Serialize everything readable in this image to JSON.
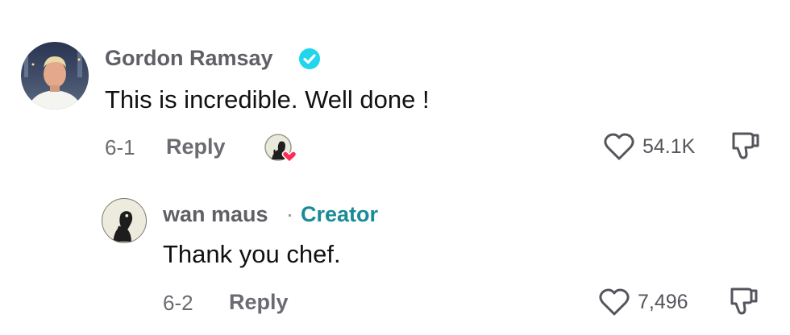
{
  "comment": {
    "username": "Gordon Ramsay",
    "verified_icon": "verified-badge-icon",
    "text": "This is incredible. Well done !",
    "date": "6-1",
    "reply_label": "Reply",
    "likes": "54.1K",
    "creator_liked_icon": "creator-heart-avatar-icon",
    "colors": {
      "verified": "#20d5ec",
      "heart": "#fe2c55"
    }
  },
  "reply": {
    "username": "wan maus",
    "separator": "·",
    "badge": "Creator",
    "text": "Thank you chef.",
    "date": "6-2",
    "reply_label": "Reply",
    "likes": "7,496",
    "colors": {
      "creator": "#1a8b95"
    }
  }
}
